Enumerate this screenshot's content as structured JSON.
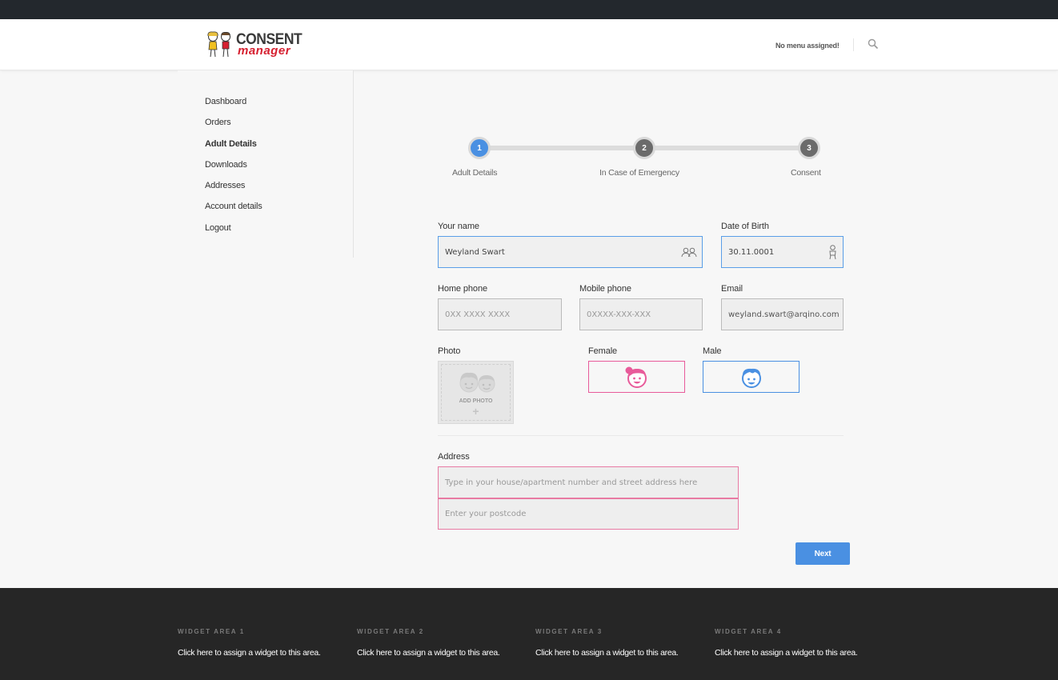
{
  "brand": {
    "line1": "CONSENT",
    "line2": "manager"
  },
  "header": {
    "menu_notice": "No menu assigned!"
  },
  "sidebar": {
    "items": [
      {
        "label": "Dashboard"
      },
      {
        "label": "Orders"
      },
      {
        "label": "Adult Details"
      },
      {
        "label": "Downloads"
      },
      {
        "label": "Addresses"
      },
      {
        "label": "Account details"
      },
      {
        "label": "Logout"
      }
    ],
    "active_item": "Adult Details"
  },
  "steps": [
    {
      "number": "1",
      "label": "Adult Details",
      "state": "active"
    },
    {
      "number": "2",
      "label": "In Case of Emergency",
      "state": "todo"
    },
    {
      "number": "3",
      "label": "Consent",
      "state": "todo"
    }
  ],
  "form": {
    "name_label": "Your name",
    "name_value": "Weyland Swart",
    "dob_label": "Date of Birth",
    "dob_value": "30.11.0001",
    "home_phone_label": "Home phone",
    "home_phone_placeholder": "0XX XXXX XXXX",
    "mobile_phone_label": "Mobile phone",
    "mobile_phone_placeholder": "0XXXX-XXX-XXX",
    "email_label": "Email",
    "email_value": "weyland.swart@arqino.com",
    "photo_label": "Photo",
    "add_photo": "ADD PHOTO",
    "female_label": "Female",
    "male_label": "Male",
    "address_label": "Address",
    "address_placeholder": "Type in your house/apartment number and street address here",
    "postcode_placeholder": "Enter your postcode",
    "next_button": "Next"
  },
  "footer": {
    "widgets": [
      {
        "title": "WIDGET AREA 1",
        "text": "Click here to assign a widget to this area."
      },
      {
        "title": "WIDGET AREA 2",
        "text": "Click here to assign a widget to this area."
      },
      {
        "title": "WIDGET AREA 3",
        "text": "Click here to assign a widget to this area."
      },
      {
        "title": "WIDGET AREA 4",
        "text": "Click here to assign a widget to this area."
      }
    ]
  },
  "colors": {
    "accent": "#4a90e2",
    "female": "#e85b9a",
    "brand_red": "#d62030",
    "topbar": "#23282d",
    "footer": "#262626"
  }
}
